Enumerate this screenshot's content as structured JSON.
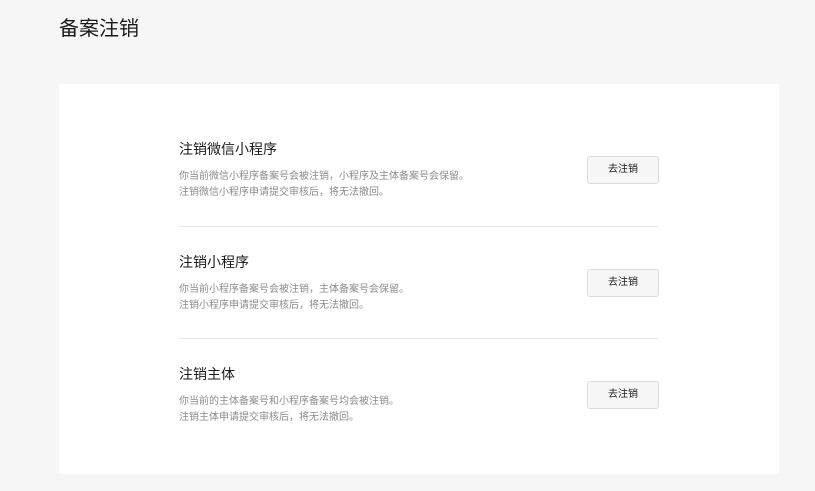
{
  "page": {
    "title": "备案注销"
  },
  "sections": [
    {
      "title": "注销微信小程序",
      "desc_line1": "你当前微信小程序备案号会被注销，小程序及主体备案号会保留。",
      "desc_line2": "注销微信小程序申请提交审核后，将无法撤回。",
      "button_label": "去注销"
    },
    {
      "title": "注销小程序",
      "desc_line1": "你当前小程序备案号会被注销，主体备案号会保留。",
      "desc_line2": "注销小程序申请提交审核后，将无法撤回。",
      "button_label": "去注销"
    },
    {
      "title": "注销主体",
      "desc_line1": "你当前的主体备案号和小程序备案号均会被注销。",
      "desc_line2": "注销主体申请提交审核后，将无法撤回。",
      "button_label": "去注销"
    }
  ]
}
